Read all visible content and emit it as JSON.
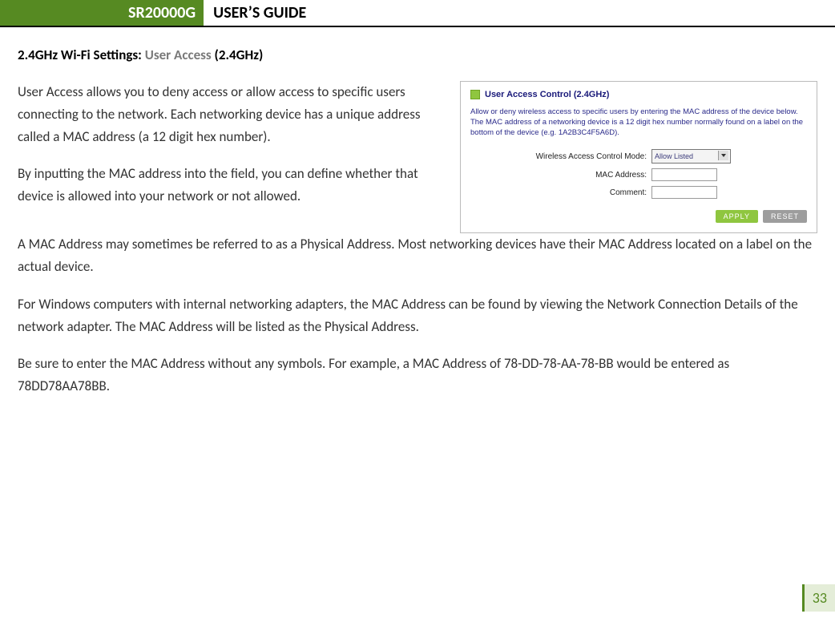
{
  "header": {
    "model": "SR20000G",
    "title": "USER’S GUIDE"
  },
  "section": {
    "prefix": "2.4GHz Wi-Fi Settings: ",
    "grey": "User Access",
    "suffix": " (2.4GHz)"
  },
  "paragraphs": {
    "p1": "User Access allows you to deny access or allow access to specific users connecting to the network. Each networking device has a unique address called a MAC address (a 12 digit hex number).",
    "p2": "By inputting the MAC address into the field, you can define whether that device is allowed into your network or not allowed.",
    "p3": "A MAC Address may sometimes be referred to as a Physical Address. Most networking devices have their MAC Address located on a label on the actual device.",
    "p4": "For Windows computers with internal networking adapters, the MAC Address can be found by viewing the Network Connection Details of the network adapter. The MAC Address will be listed as the Physical Address.",
    "p5": "Be sure to enter the MAC Address without any symbols. For example, a MAC Address of 78-DD-78-AA-78-BB would be entered as 78DD78AA78BB."
  },
  "panel": {
    "title": "User Access Control (2.4GHz)",
    "desc": "Allow or deny wireless access to specific users by entering the MAC address of the device below. The MAC address of a networking device is a 12 digit hex number normally found on a label on the bottom of the device (e.g. 1A2B3C4F5A6D).",
    "labels": {
      "mode": "Wireless Access Control Mode:",
      "mac": "MAC Address:",
      "comment": "Comment:"
    },
    "mode_value": "Allow Listed",
    "buttons": {
      "apply": "APPLY",
      "reset": "RESET"
    }
  },
  "page_number": "33"
}
